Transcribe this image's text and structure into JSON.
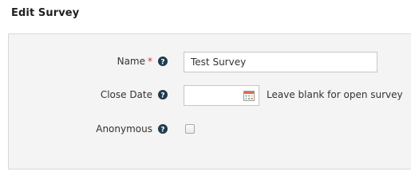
{
  "title": "Edit Survey",
  "form": {
    "name": {
      "label": "Name",
      "required_mark": "*",
      "value": "Test Survey"
    },
    "close_date": {
      "label": "Close Date",
      "value": "",
      "hint": "Leave blank for open survey"
    },
    "anonymous": {
      "label": "Anonymous",
      "checked": false
    }
  },
  "icons": {
    "help": "question-circle-icon",
    "calendar": "calendar-icon"
  },
  "colors": {
    "required": "#d0342c",
    "help_icon": "#1f3b4d",
    "panel_bg": "#f4f4f4"
  }
}
